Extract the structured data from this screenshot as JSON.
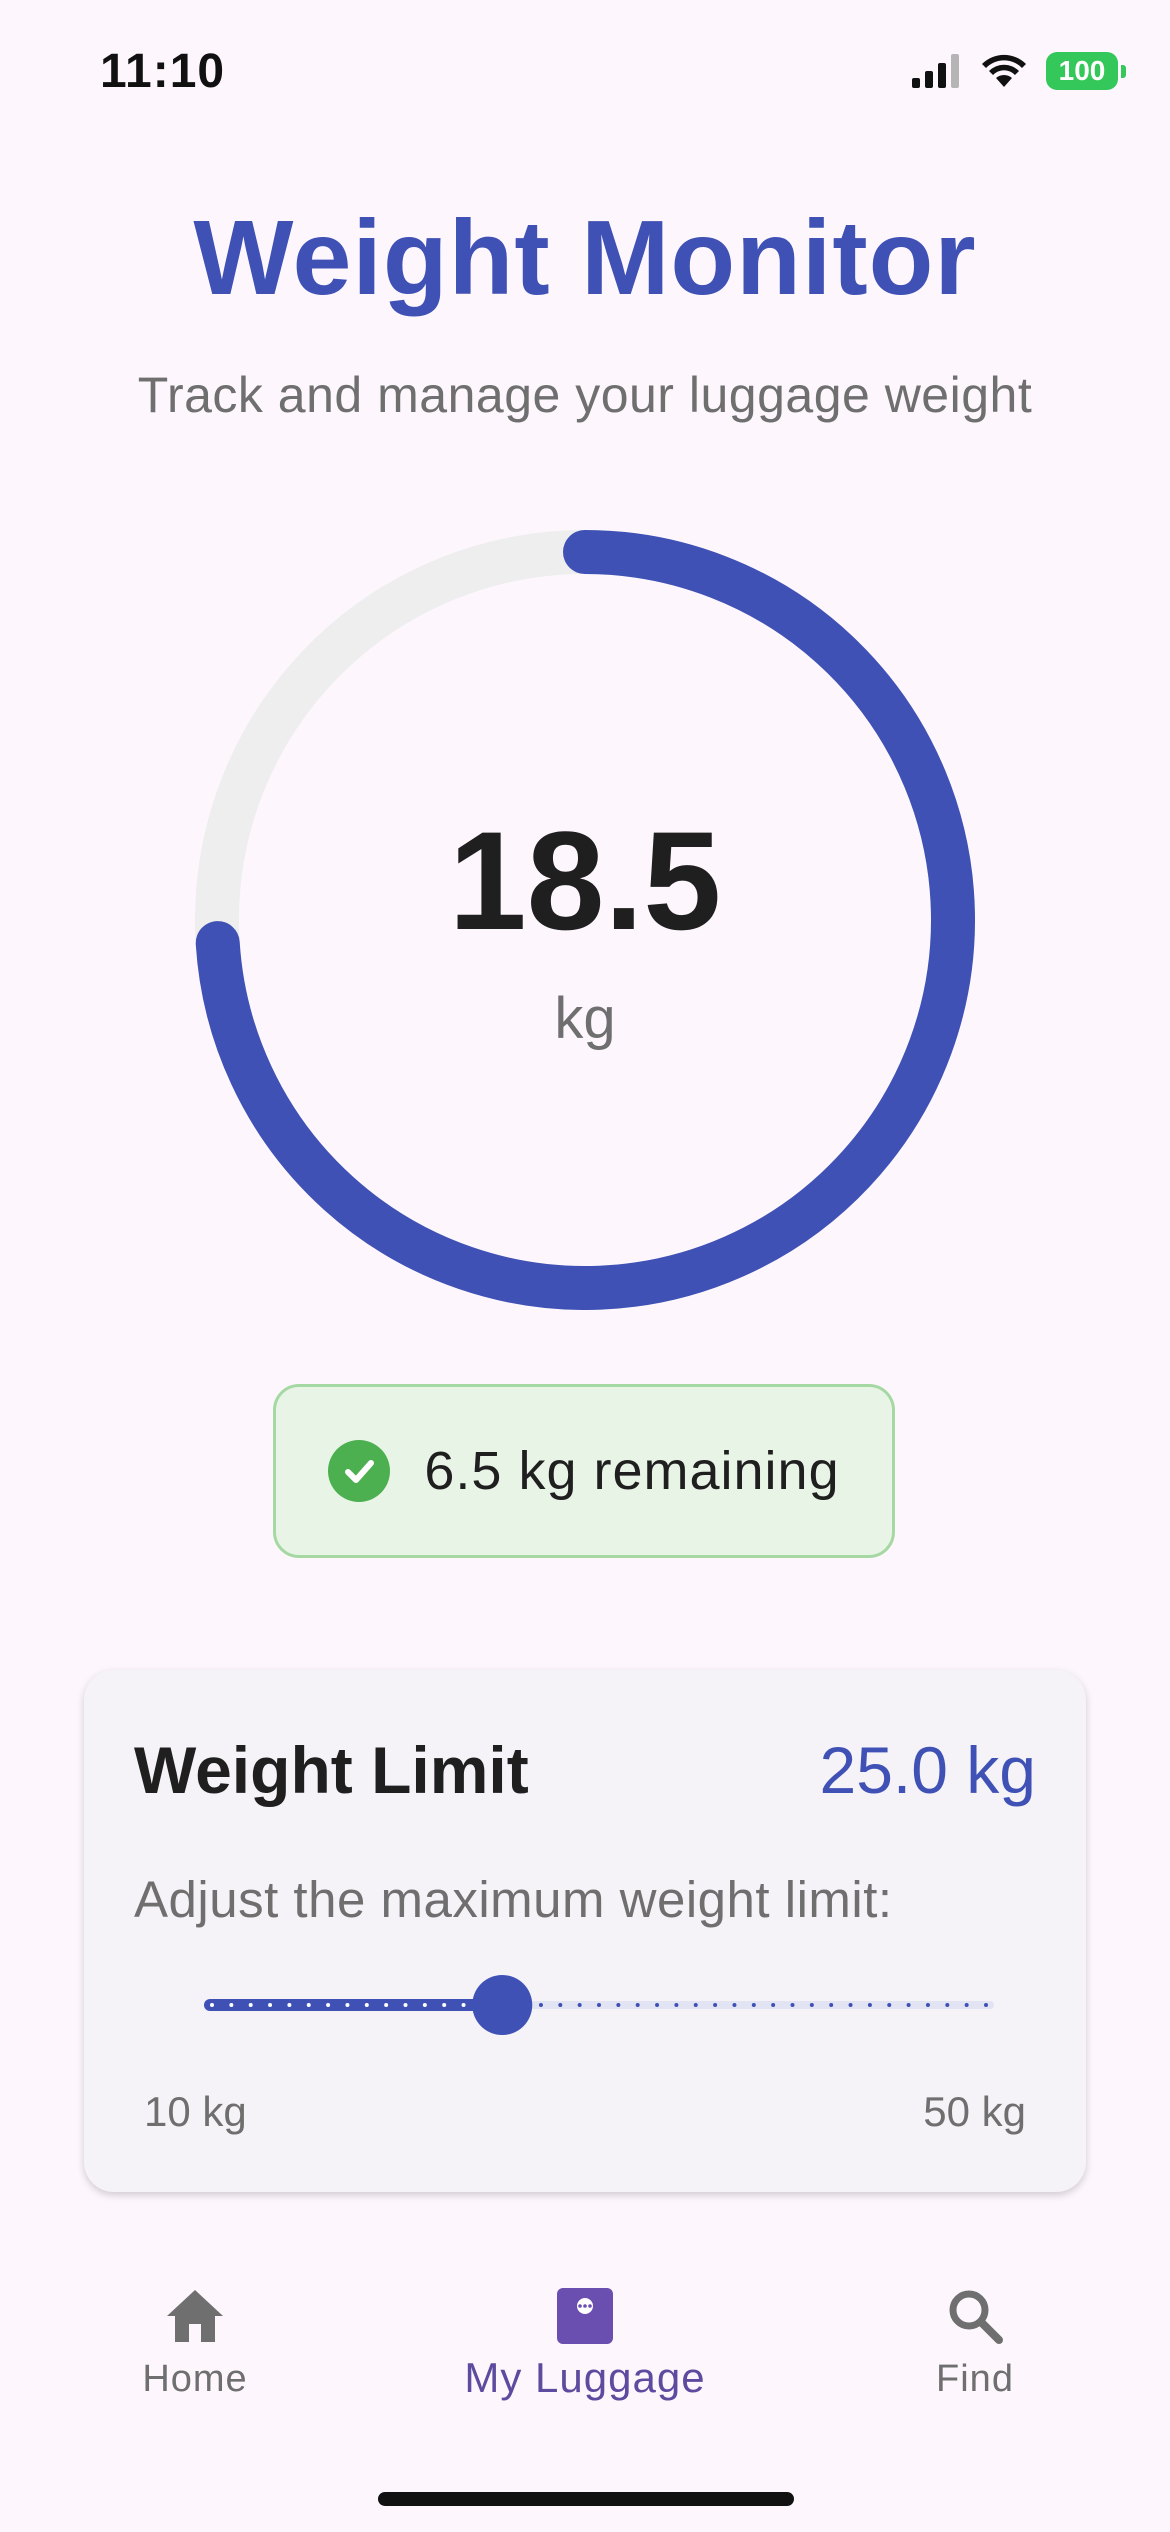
{
  "status_bar": {
    "time": "11:10",
    "battery": "100",
    "icons": [
      "signal-icon",
      "wifi-icon",
      "battery-icon"
    ]
  },
  "header": {
    "title": "Weight Monitor",
    "subtitle": "Track and manage your luggage weight"
  },
  "gauge": {
    "value": "18.5",
    "unit": "kg",
    "fill_fraction": 0.74,
    "color": "#3f51b5",
    "track_color": "#eeeeee"
  },
  "remaining": {
    "text": "6.5 kg remaining",
    "icon": "check-circle-icon",
    "color": "#4caf50"
  },
  "weight_limit": {
    "title": "Weight Limit",
    "value": "25.0 kg",
    "description": "Adjust the maximum weight limit:",
    "slider_min_label": "10 kg",
    "slider_max_label": "50 kg",
    "slider_fraction": 0.375
  },
  "nav": {
    "items": [
      {
        "label": "Home",
        "icon": "home-icon"
      },
      {
        "label": "My Luggage",
        "icon": "luggage-icon",
        "active": true
      },
      {
        "label": "Find",
        "icon": "search-icon"
      }
    ]
  }
}
